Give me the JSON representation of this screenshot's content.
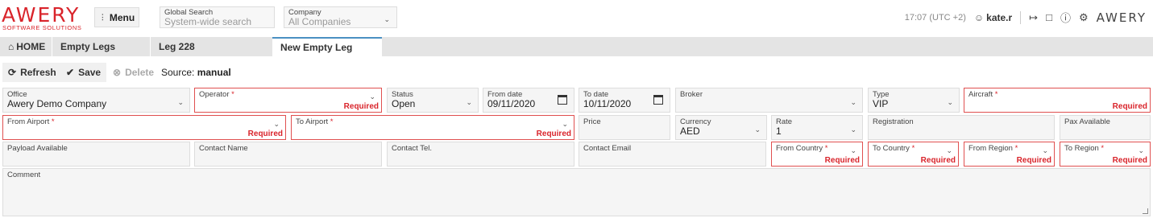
{
  "header": {
    "logo_text": "AWERY",
    "logo_tagline": "SOFTWARE SOLUTIONS",
    "menu_label": "Menu",
    "global_search_label": "Global Search",
    "global_search_placeholder": "System-wide search",
    "company_label": "Company",
    "company_value": "All Companies",
    "time": "17:07 (UTC +2)",
    "username": "kate.r",
    "brand_small": "AWERY"
  },
  "tabs": [
    {
      "label": "HOME"
    },
    {
      "label": "Empty Legs"
    },
    {
      "label": "Leg 228"
    },
    {
      "label": "New Empty Leg"
    }
  ],
  "toolbar": {
    "refresh_label": "Refresh",
    "save_label": "Save",
    "delete_label": "Delete",
    "source_label": "Source:",
    "source_value": "manual"
  },
  "form": {
    "required_text": "Required",
    "office": {
      "label": "Office",
      "value": "Awery Demo Company"
    },
    "operator": {
      "label": "Operator",
      "value": ""
    },
    "status": {
      "label": "Status",
      "value": "Open"
    },
    "from_date": {
      "label": "From date",
      "value": "09/11/2020"
    },
    "to_date": {
      "label": "To date",
      "value": "10/11/2020"
    },
    "broker": {
      "label": "Broker",
      "value": ""
    },
    "type": {
      "label": "Type",
      "value": "VIP"
    },
    "aircraft": {
      "label": "Aircraft",
      "value": ""
    },
    "from_airport": {
      "label": "From Airport",
      "value": ""
    },
    "to_airport": {
      "label": "To Airport",
      "value": ""
    },
    "price": {
      "label": "Price",
      "value": ""
    },
    "currency": {
      "label": "Currency",
      "value": "AED"
    },
    "rate": {
      "label": "Rate",
      "value": "1"
    },
    "registration": {
      "label": "Registration",
      "value": ""
    },
    "pax_available": {
      "label": "Pax Available",
      "value": ""
    },
    "payload_available": {
      "label": "Payload Available",
      "value": ""
    },
    "contact_name": {
      "label": "Contact Name",
      "value": ""
    },
    "contact_tel": {
      "label": "Contact Tel.",
      "value": ""
    },
    "contact_email": {
      "label": "Contact Email",
      "value": ""
    },
    "from_country": {
      "label": "From Country",
      "value": ""
    },
    "to_country": {
      "label": "To Country",
      "value": ""
    },
    "from_region": {
      "label": "From Region",
      "value": ""
    },
    "to_region": {
      "label": "To Region",
      "value": ""
    },
    "comment": {
      "label": "Comment",
      "value": ""
    }
  },
  "colors": {
    "brand": "#d9242b",
    "tab_active_border": "#4a90c2",
    "required_border": "#e05050"
  }
}
